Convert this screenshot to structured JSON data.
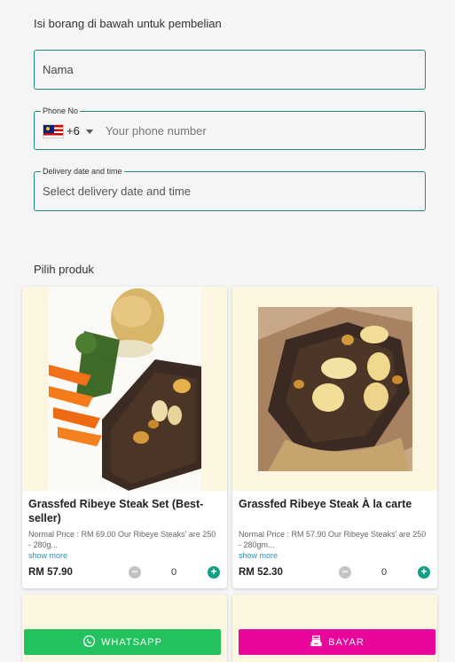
{
  "form": {
    "intro": "Isi borang di bawah untuk pembelian",
    "name_placeholder": "Nama",
    "phone_label": "Phone No",
    "country_code": "+6",
    "phone_placeholder": "Your phone number",
    "delivery_label": "Delivery date and time",
    "delivery_placeholder": "Select delivery date and time"
  },
  "products": {
    "section_title": "Pilih produk",
    "items": [
      {
        "name": "Grassfed Ribeye Steak Set (Best-seller)",
        "description": "Normal Price : RM 69.00 Our Ribeye Steaks' are 250 - 280g...",
        "show_more": "show more",
        "price": "RM 57.90",
        "quantity": "0"
      },
      {
        "name": "Grassfed Ribeye Steak À la carte",
        "description": "Normal Price : RM 57.90 Our Ribeye Steaks' are 250 - 280gm...",
        "show_more": "show more",
        "price": "RM 52.30",
        "quantity": "0"
      }
    ]
  },
  "actions": {
    "whatsapp_label": "WHATSAPP",
    "pay_label": "BAYAR"
  },
  "colors": {
    "accent": "#1f8a7c",
    "whatsapp": "#22c35e",
    "pay": "#e8079a",
    "plus": "#15a085"
  },
  "icons": [
    "malaysia-flag-icon",
    "chevron-down-icon",
    "minus-icon",
    "plus-icon",
    "whatsapp-icon",
    "cash-register-icon"
  ]
}
